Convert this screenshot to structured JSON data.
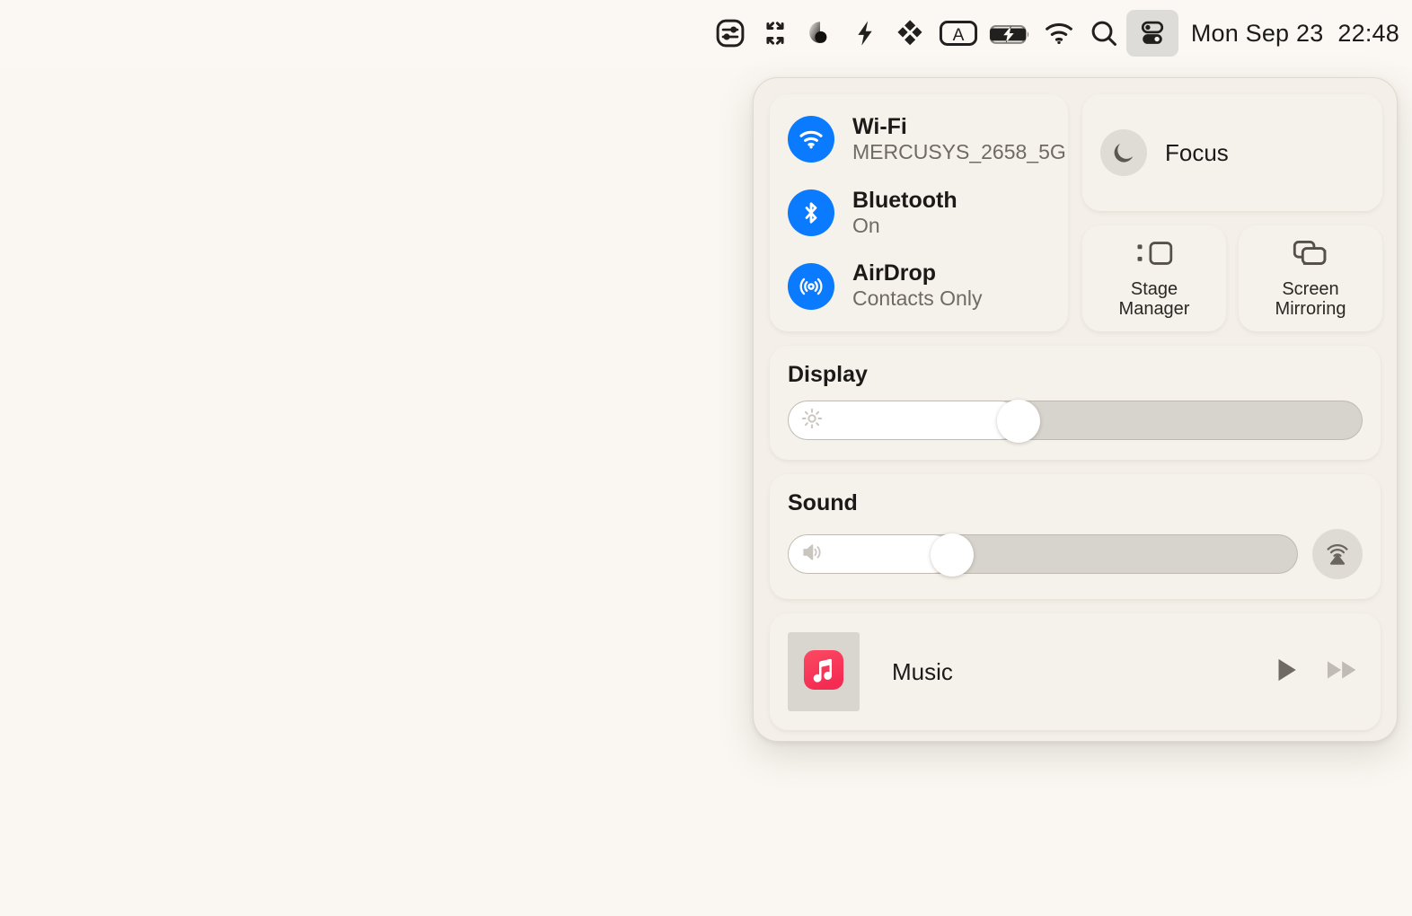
{
  "menubar": {
    "icons": [
      {
        "name": "controls-slider-icon",
        "label": "Controls"
      },
      {
        "name": "collapse-arrows-icon",
        "label": "Rectangle"
      },
      {
        "name": "dark-mode-circle-icon",
        "label": "Dark Mode"
      },
      {
        "name": "lightning-bolt-icon",
        "label": "Power"
      },
      {
        "name": "dropbox-diamonds-icon",
        "label": "Dropbox"
      },
      {
        "name": "input-source-a-icon",
        "label": "A"
      },
      {
        "name": "battery-charging-icon",
        "label": "Battery"
      },
      {
        "name": "wifi-icon",
        "label": "Wi-Fi"
      },
      {
        "name": "search-icon",
        "label": "Spotlight"
      },
      {
        "name": "control-center-icon",
        "label": "Control Center"
      }
    ],
    "clock": {
      "date": "Mon Sep 23",
      "time": "22:48"
    }
  },
  "control_center": {
    "connectivity": [
      {
        "icon": "wifi-icon",
        "title": "Wi-Fi",
        "status": "MERCUSYS_2658_5G"
      },
      {
        "icon": "bluetooth-icon",
        "title": "Bluetooth",
        "status": "On"
      },
      {
        "icon": "airdrop-icon",
        "title": "AirDrop",
        "status": "Contacts Only"
      }
    ],
    "focus": {
      "label": "Focus",
      "icon": "moon-icon"
    },
    "tiles": [
      {
        "label": "Stage\nManager",
        "line1": "Stage",
        "line2": "Manager",
        "icon": "stage-manager-icon"
      },
      {
        "label": "Screen\nMirroring",
        "line1": "Screen",
        "line2": "Mirroring",
        "icon": "screen-mirroring-icon"
      }
    ],
    "display": {
      "title": "Display",
      "value_percent": 40,
      "icon": "brightness-sun-icon"
    },
    "sound": {
      "title": "Sound",
      "value_percent": 32,
      "icon": "speaker-icon",
      "output_button": "airplay-icon"
    },
    "music": {
      "app_name": "Music",
      "artwork_icon": "apple-music-icon",
      "play_label": "Play",
      "next_label": "Fast Forward"
    },
    "colors": {
      "accent_blue": "#0a7aff",
      "panel_bg": "#f4efe8",
      "card_bg": "#f5f2ec",
      "desktop_bg": "#faf7f2",
      "music_red": "#fa3c55"
    }
  }
}
